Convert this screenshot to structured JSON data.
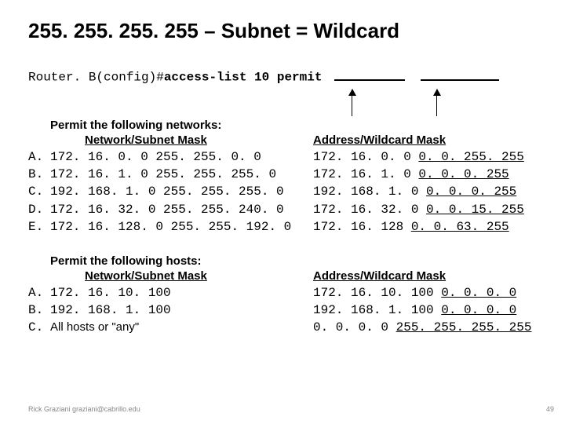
{
  "title": "255. 255. 255. 255 – Subnet = Wildcard",
  "cmd": {
    "prefix": "Router. B(config)#",
    "bold": "access-list 10 permit"
  },
  "headers": {
    "nets_title": "Permit the following networks:",
    "nets_sub": "Network/Subnet Mask",
    "wild_title": "Address/Wildcard Mask",
    "hosts_title": "Permit the following hosts:",
    "hosts_sub": "Network/Subnet Mask"
  },
  "networks": [
    {
      "letter": "A.",
      "left": "172. 16. 0. 0 255. 255. 0. 0",
      "r_addr": "172. 16. 0. 0 ",
      "r_mask": "0. 0. 255. 255"
    },
    {
      "letter": "B.",
      "left": "172. 16. 1. 0 255. 255. 255. 0",
      "r_addr": "172. 16. 1. 0 ",
      "r_mask": "0. 0. 0. 255"
    },
    {
      "letter": "C.",
      "left": "192. 168. 1. 0 255. 255. 255. 0",
      "r_addr": "192. 168. 1. 0 ",
      "r_mask": "0. 0. 0. 255"
    },
    {
      "letter": "D.",
      "left": "172. 16. 32. 0 255. 255. 240. 0",
      "r_addr": "172. 16. 32. 0 ",
      "r_mask": "0. 0. 15. 255"
    },
    {
      "letter": "E.",
      "left": "172. 16. 128. 0 255. 255. 192. 0",
      "r_addr": "172. 16. 128 ",
      "r_mask": "0. 0. 63. 255"
    }
  ],
  "hosts": [
    {
      "letter": "A.",
      "left": "172. 16. 10. 100",
      "left_sans": false,
      "r_addr": "172. 16. 10. 100 ",
      "r_mask": "0. 0. 0. 0"
    },
    {
      "letter": "B.",
      "left": "192. 168. 1. 100",
      "left_sans": false,
      "r_addr": "192. 168. 1. 100 ",
      "r_mask": "0. 0. 0. 0"
    },
    {
      "letter": "C.",
      "left": "All hosts or \"any\"",
      "left_sans": true,
      "r_addr": "0. 0. 0. 0 ",
      "r_mask": "255. 255. 255. 255"
    }
  ],
  "footer": "Rick Graziani graziani@cabrillo.edu",
  "page": "49"
}
